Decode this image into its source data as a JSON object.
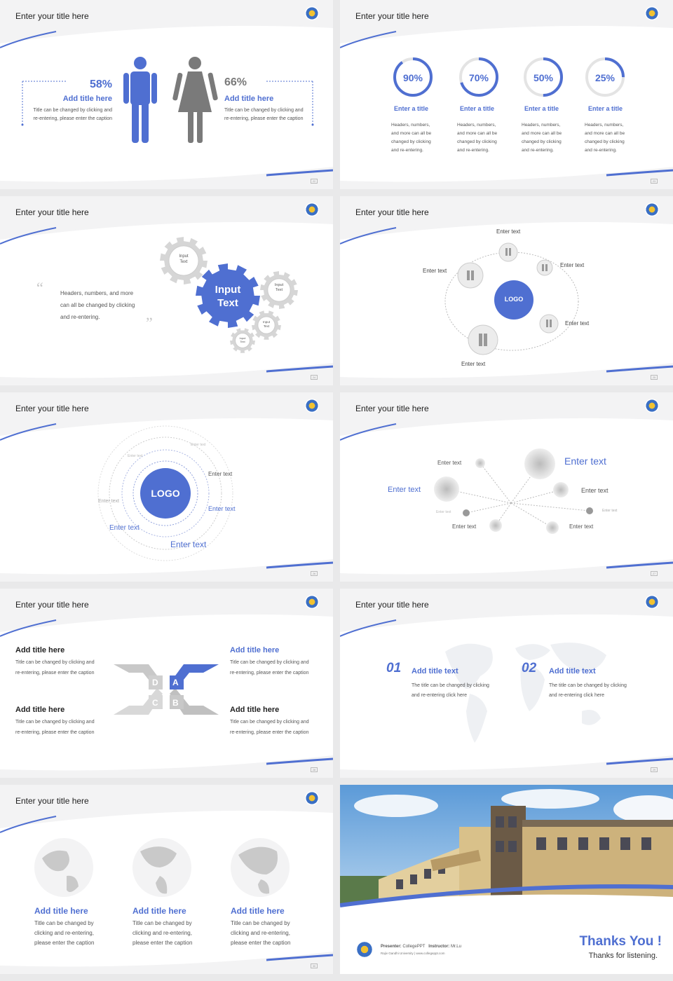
{
  "colors": {
    "accent": "#4f6fd1",
    "gray": "#8a8a8a",
    "light": "#d0d0d0"
  },
  "common": {
    "slide_title": "Enter your title here",
    "emblem_icon": "university-emblem-icon"
  },
  "s1": {
    "left": {
      "pct": "58%",
      "title": "Add title here",
      "body1": "Title can be changed by clicking and",
      "body2": "re-entering, please enter the caption"
    },
    "right": {
      "pct": "66%",
      "title": "Add title here",
      "body1": "Title can be changed by clicking and",
      "body2": "re-entering, please enter the caption"
    },
    "page": "22"
  },
  "s2": {
    "items": [
      {
        "pct": "90%",
        "value": 0.9,
        "title": "Enter a title",
        "l1": "Headers, numbers,",
        "l2": "and more can all be",
        "l3": "changed by clicking",
        "l4": "and re-entering."
      },
      {
        "pct": "70%",
        "value": 0.7,
        "title": "Enter a title",
        "l1": "Headers, numbers,",
        "l2": "and more can all be",
        "l3": "changed by clicking",
        "l4": "and re-entering."
      },
      {
        "pct": "50%",
        "value": 0.5,
        "title": "Enter a title",
        "l1": "Headers, numbers,",
        "l2": "and more can all be",
        "l3": "changed by clicking",
        "l4": "and re-entering."
      },
      {
        "pct": "25%",
        "value": 0.25,
        "title": "Enter a title",
        "l1": "Headers, numbers,",
        "l2": "and more can all be",
        "l3": "changed by clicking",
        "l4": "and re-entering."
      }
    ],
    "page": "23"
  },
  "s3": {
    "quote1": "Headers, numbers, and more",
    "quote2": "can all be changed by clicking",
    "quote3": "and re-entering.",
    "gear_big_1": "Input",
    "gear_big_2": "Text",
    "gear_a_1": "Input",
    "gear_a_2": "Text",
    "gear_b_1": "Input",
    "gear_b_2": "Text",
    "gear_c_1": "Input",
    "gear_c_2": "Text",
    "gear_d_1": "Input",
    "gear_d_2": "Text",
    "page": "24"
  },
  "s4": {
    "logo": "LOGO",
    "labels": [
      "Enter text",
      "Enter text",
      "Enter text",
      "Enter text",
      "Enter text"
    ],
    "page": "25"
  },
  "s5": {
    "logo": "LOGO",
    "labels": [
      "Enter text",
      "Enter text",
      "Enter text",
      "Enter text",
      "Enter text",
      "Enter text",
      "Enter text"
    ],
    "page": "26"
  },
  "s6": {
    "labels": [
      "Enter text",
      "Enter text",
      "Enter text",
      "Enter text",
      "Enter text",
      "Enter text",
      "Enter text",
      "Enter text"
    ],
    "page": "27"
  },
  "s7": {
    "items": [
      {
        "title": "Add title here",
        "l1": "Title can be changed by clicking and",
        "l2": "re-entering, please enter the caption"
      },
      {
        "title": "Add title here",
        "l1": "Title can be changed by clicking and",
        "l2": "re-entering, please enter the caption"
      },
      {
        "title": "Add title here",
        "l1": "Title can be changed by clicking and",
        "l2": "re-entering, please enter the caption"
      },
      {
        "title": "Add title here",
        "l1": "Title can be changed by clicking and",
        "l2": "re-entering, please enter the caption"
      }
    ],
    "letters": [
      "A",
      "B",
      "C",
      "D"
    ],
    "page": "28"
  },
  "s8": {
    "items": [
      {
        "num": "01",
        "title": "Add title text",
        "l1": "The title can be changed by clicking",
        "l2": "and re-entering click here"
      },
      {
        "num": "02",
        "title": "Add title text",
        "l1": "The title can be changed by clicking",
        "l2": "and re-entering click here"
      }
    ],
    "page": "29"
  },
  "s9": {
    "items": [
      {
        "title": "Add title here",
        "l1": "Title can be changed by",
        "l2": "clicking and re-entering,",
        "l3": "please enter the caption"
      },
      {
        "title": "Add title here",
        "l1": "Title can be changed by",
        "l2": "clicking and re-entering,",
        "l3": "please enter the caption"
      },
      {
        "title": "Add title here",
        "l1": "Title can be changed by",
        "l2": "clicking and re-entering,",
        "l3": "please enter the caption"
      }
    ],
    "page": "30"
  },
  "s10": {
    "presenter_label": "Presenter:",
    "presenter": "CollegePPT",
    "instructor_label": "Instructor:",
    "instructor": "Mr.Lu",
    "university": "Rajiv Gandhi University  |  www.collegeppt.com",
    "thanks": "Thanks You !",
    "sub": "Thanks for listening."
  }
}
